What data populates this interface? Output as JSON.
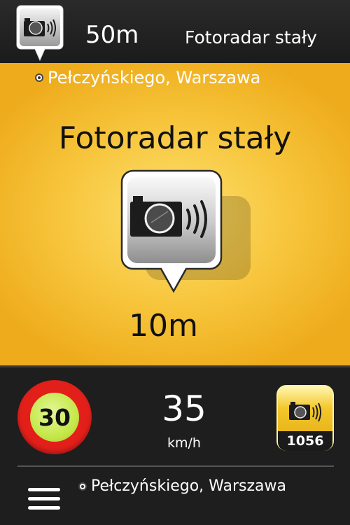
{
  "top_bar": {
    "icon": "speed-camera-pin-icon",
    "distance": "50m",
    "alert_type": "Fotoradar stały"
  },
  "alert": {
    "address": "Pełczyńskiego, Warszawa",
    "title": "Fotoradar stały",
    "icon": "speed-camera-icon",
    "distance": "10m",
    "background_color": "#f7c53c"
  },
  "bottom_panel": {
    "speed_limit": "30",
    "current_speed": "35",
    "speed_unit": "km/h",
    "camera_count": "1056",
    "address": "Pełczyńskiego, Warszawa",
    "menu_icon": "hamburger-menu-icon",
    "limit_sign_color": "#e31f1a"
  }
}
